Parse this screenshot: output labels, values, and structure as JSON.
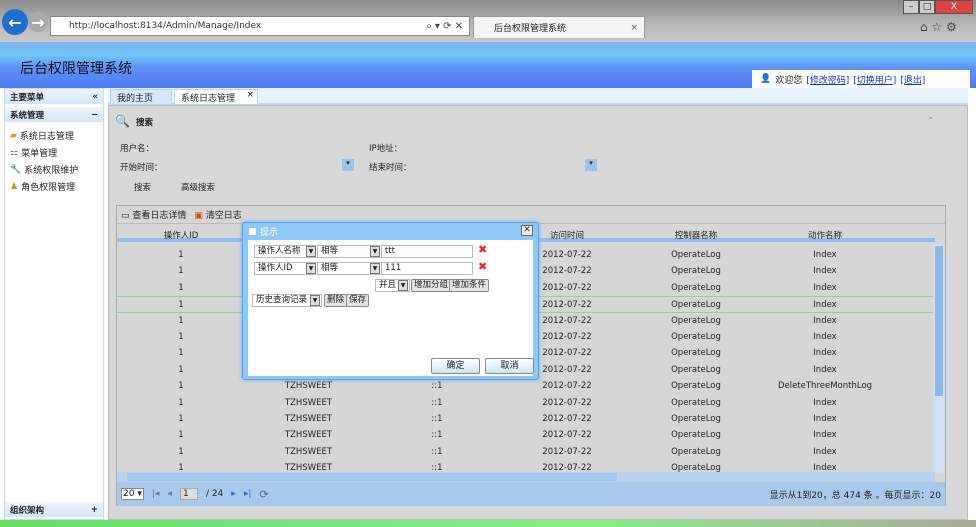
{
  "browser": {
    "url": "http://localhost:8134/Admin/Manage/Index",
    "tab_title": "后台权限管理系统"
  },
  "header": {
    "title": "后台权限管理系统",
    "welcome": "欢迎您",
    "change_password": "[修改密码]",
    "switch_user": "[切换用户]",
    "logout": "[退出]"
  },
  "sidebar": {
    "title": "主要菜单",
    "collapse": "«",
    "group": "系统管理",
    "group_toggle": "−",
    "items": [
      {
        "label": "系统日志管理",
        "icon": "folder-icon"
      },
      {
        "label": "菜单管理",
        "icon": "menu-tree-icon"
      },
      {
        "label": "系统权限维护",
        "icon": "wrench-icon"
      },
      {
        "label": "角色权限管理",
        "icon": "roles-icon"
      }
    ],
    "footer": "组织架构",
    "footer_toggle": "+"
  },
  "tabs": [
    {
      "label": "我的主页"
    },
    {
      "label": "系统日志管理",
      "close": "×"
    }
  ],
  "search": {
    "title": "搜索",
    "username_label": "用户名：",
    "ip_label": "IP地址：",
    "start_label": "开始时间：",
    "end_label": "结束时间：",
    "search_btn": "搜索",
    "advanced_btn": "高级搜索"
  },
  "grid": {
    "toolbar": {
      "view_detail": "查看日志详情",
      "clear": "清空日志"
    },
    "columns": [
      "操作人ID",
      "",
      "",
      "访问时间",
      "控制器名称",
      "动作名称"
    ],
    "rows": [
      [
        "1",
        "",
        "",
        "2012-07-22",
        "OperateLog",
        "Index"
      ],
      [
        "1",
        "",
        "",
        "2012-07-22",
        "OperateLog",
        "Index"
      ],
      [
        "1",
        "",
        "",
        "2012-07-22",
        "OperateLog",
        "Index"
      ],
      [
        "1",
        "",
        "",
        "2012-07-22",
        "OperateLog",
        "Index"
      ],
      [
        "1",
        "",
        "",
        "2012-07-22",
        "OperateLog",
        "Index"
      ],
      [
        "1",
        "",
        "",
        "2012-07-22",
        "OperateLog",
        "Index"
      ],
      [
        "1",
        "",
        "",
        "2012-07-22",
        "OperateLog",
        "Index"
      ],
      [
        "1",
        "",
        "",
        "2012-07-22",
        "OperateLog",
        "Index"
      ],
      [
        "1",
        "TZHSWEET",
        "::1",
        "2012-07-22",
        "OperateLog",
        "DeleteThreeMonthLog"
      ],
      [
        "1",
        "TZHSWEET",
        "::1",
        "2012-07-22",
        "OperateLog",
        "Index"
      ],
      [
        "1",
        "TZHSWEET",
        "::1",
        "2012-07-22",
        "OperateLog",
        "Index"
      ],
      [
        "1",
        "TZHSWEET",
        "::1",
        "2012-07-22",
        "OperateLog",
        "Index"
      ],
      [
        "1",
        "TZHSWEET",
        "::1",
        "2012-07-22",
        "OperateLog",
        "Index"
      ],
      [
        "1",
        "TZHSWEET",
        "::1",
        "2012-07-22",
        "OperateLog",
        "Index"
      ]
    ],
    "pager": {
      "page_size": "20",
      "page": "1",
      "total_pages": "/ 24",
      "summary": "显示从1到20，总 474 条 。每页显示：20"
    }
  },
  "dialog": {
    "title": "提示",
    "conditions": [
      {
        "field": "操作人名称",
        "op": "相等",
        "value": "ttt"
      },
      {
        "field": "操作人ID",
        "op": "相等",
        "value": "111"
      }
    ],
    "logic": "并且",
    "add_group": "增加分组",
    "add_condition": "增加条件",
    "history": "历史查询记录",
    "delete": "删除",
    "save": "保存",
    "ok": "确定",
    "cancel": "取消"
  }
}
